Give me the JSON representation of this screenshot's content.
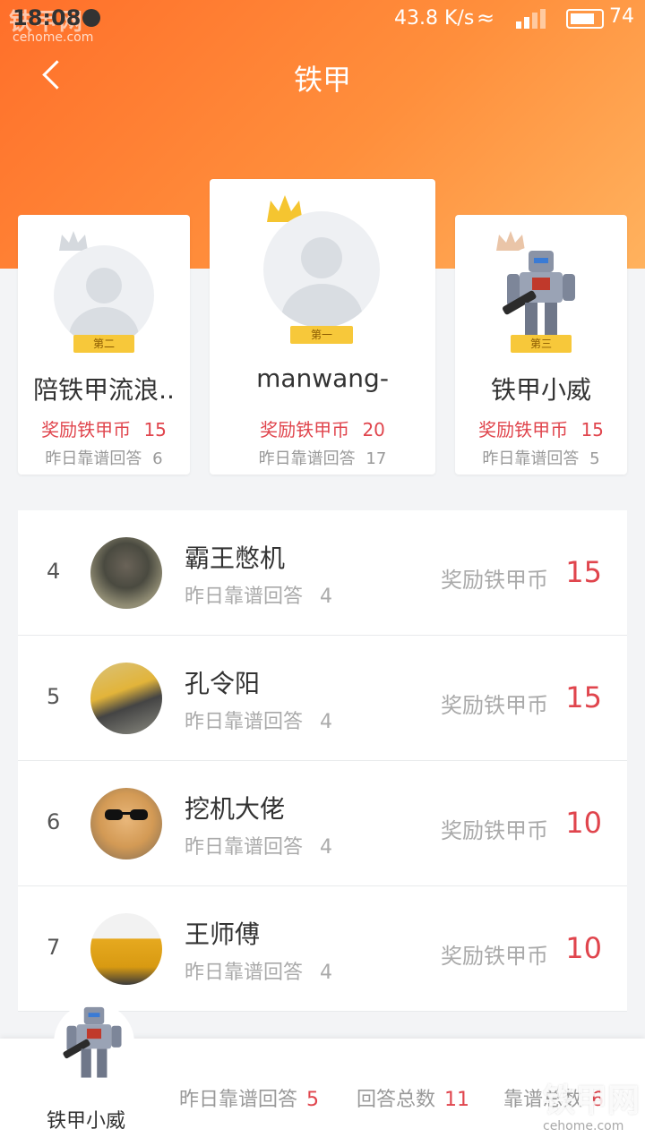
{
  "status_bar": {
    "time": "18:08",
    "speed": "43.8 K/s",
    "battery": "74",
    "watermark": "铁甲网",
    "watermark_url": "cehome.com"
  },
  "header": {
    "title": "铁甲"
  },
  "podium": [
    {
      "rank_label": "第二",
      "name": "陪铁甲流浪..",
      "reward_label": "奖励铁甲币",
      "reward_value": "15",
      "reliable_label": "昨日靠谱回答",
      "reliable_value": "6"
    },
    {
      "rank_label": "第一",
      "name": "manwang-",
      "reward_label": "奖励铁甲币",
      "reward_value": "20",
      "reliable_label": "昨日靠谱回答",
      "reliable_value": "17"
    },
    {
      "rank_label": "第三",
      "name": "铁甲小威",
      "reward_label": "奖励铁甲币",
      "reward_value": "15",
      "reliable_label": "昨日靠谱回答",
      "reliable_value": "5"
    }
  ],
  "list": [
    {
      "rank": "4",
      "name": "霸王憋机",
      "reliable_label": "昨日靠谱回答",
      "reliable_value": "4",
      "reward_label": "奖励铁甲币",
      "reward_value": "15"
    },
    {
      "rank": "5",
      "name": "孔令阳",
      "reliable_label": "昨日靠谱回答",
      "reliable_value": "4",
      "reward_label": "奖励铁甲币",
      "reward_value": "15"
    },
    {
      "rank": "6",
      "name": "挖机大佬",
      "reliable_label": "昨日靠谱回答",
      "reliable_value": "4",
      "reward_label": "奖励铁甲币",
      "reward_value": "10"
    },
    {
      "rank": "7",
      "name": "王师傅",
      "reliable_label": "昨日靠谱回答",
      "reliable_value": "4",
      "reward_label": "奖励铁甲币",
      "reward_value": "10"
    }
  ],
  "me": {
    "name": "铁甲小威",
    "stats": [
      {
        "label": "昨日靠谱回答",
        "value": "5"
      },
      {
        "label": "回答总数",
        "value": "11"
      },
      {
        "label": "靠谱总数",
        "value": "6"
      }
    ]
  },
  "colors": {
    "accent": "#ff7a2f",
    "reward": "#e0454d"
  }
}
